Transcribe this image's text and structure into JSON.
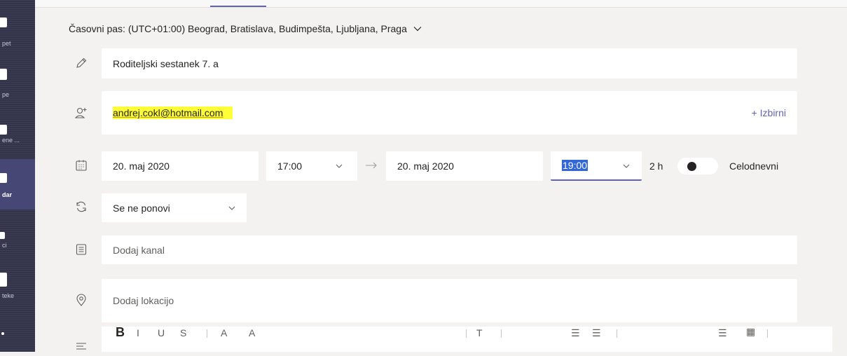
{
  "rail": {
    "items": [
      {
        "label": "pet",
        "active": false
      },
      {
        "label": "pe",
        "active": false
      },
      {
        "label": "ene ...",
        "active": false
      },
      {
        "label": "dar",
        "active": true
      },
      {
        "label": "ci",
        "active": false
      },
      {
        "label": "teke",
        "active": false
      }
    ]
  },
  "timezone": {
    "label": "Časovni pas: (UTC+01:00) Beograd, Bratislava, Budimpešta, Ljubljana, Praga"
  },
  "title_field": {
    "value": "Roditeljski sestanek 7. a"
  },
  "attendees": {
    "value": "andrej.cokl@hotmail.com",
    "highlight_color": "#ffff38",
    "optional_link": "+ Izbirni"
  },
  "datetime": {
    "start_date": "20. maj 2020",
    "start_time": "17:00",
    "end_date": "20. maj 2020",
    "end_time": "19:00",
    "duration": "2 h",
    "all_day_label": "Celodnevni",
    "all_day_on": false
  },
  "recurrence": {
    "value": "Se ne ponovi"
  },
  "channel": {
    "placeholder": "Dodaj kanal"
  },
  "location": {
    "placeholder": "Dodaj lokacijo"
  },
  "colors": {
    "rail": "#33344a",
    "accent": "#6264a7",
    "background": "#f3f2f1",
    "field": "#ffffff"
  }
}
